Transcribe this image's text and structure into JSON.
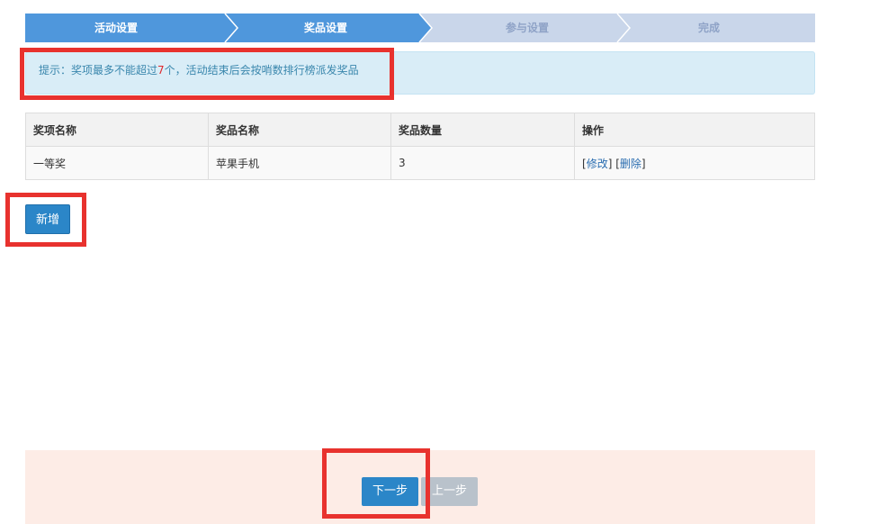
{
  "steps": [
    {
      "label": "活动设置",
      "state": "active"
    },
    {
      "label": "奖品设置",
      "state": "active"
    },
    {
      "label": "参与设置",
      "state": "inactive"
    },
    {
      "label": "完成",
      "state": "inactive"
    }
  ],
  "hint": {
    "prefix": "提示：奖项最多不能超过",
    "max_count": "7",
    "suffix": "个，活动结束后会按哨数排行榜派发奖品"
  },
  "table": {
    "headers": [
      "奖项名称",
      "奖品名称",
      "奖品数量",
      "操作"
    ],
    "rows": [
      {
        "award": "一等奖",
        "prize": "苹果手机",
        "quantity": "3",
        "edit": "修改",
        "delete": "删除"
      }
    ]
  },
  "buttons": {
    "add": "新增",
    "next": "下一步",
    "prev": "上一步"
  },
  "colors": {
    "step_active": "#4f97dc",
    "step_inactive": "#c9d6ea",
    "annotation": "#e8322e"
  }
}
